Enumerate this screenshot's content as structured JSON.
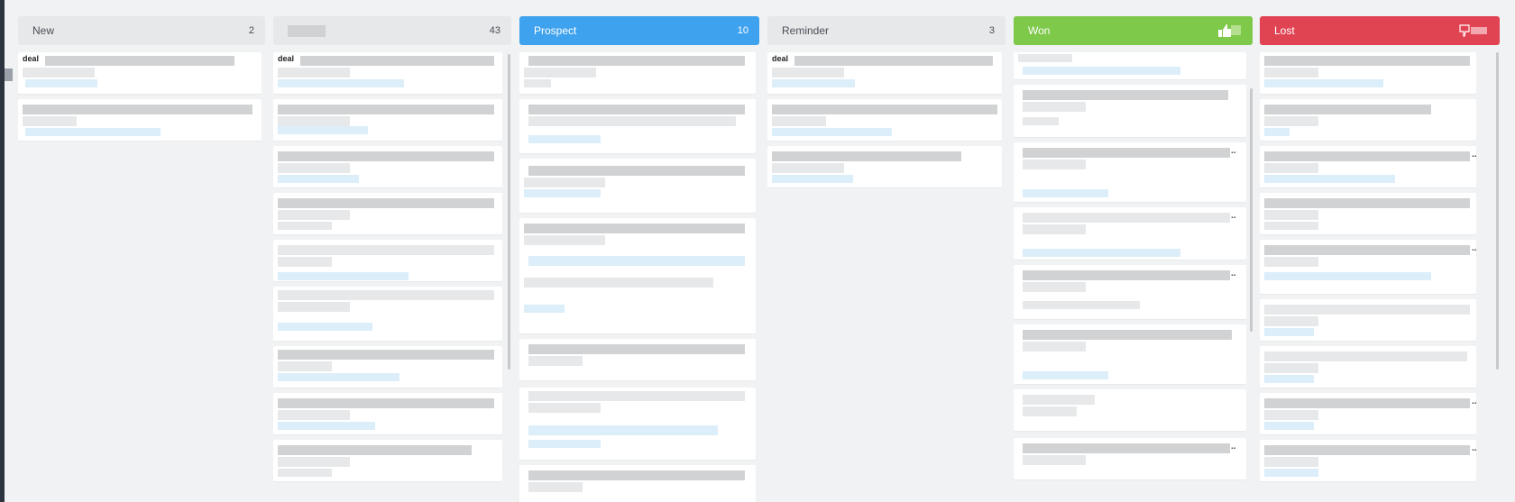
{
  "board": {
    "columns": [
      {
        "title": "New",
        "count": "2"
      },
      {
        "title": "",
        "count": "43"
      },
      {
        "title": "Prospect",
        "count": "10"
      },
      {
        "title": "Reminder",
        "count": "3"
      },
      {
        "title": "Won",
        "count": ""
      },
      {
        "title": "Lost",
        "count": ""
      }
    ],
    "card_prefix": "deal",
    "more_marker": "..",
    "accent_colors": {
      "prospect": "#3fa2ee",
      "won": "#7ec84a",
      "lost": "#e04452"
    }
  }
}
